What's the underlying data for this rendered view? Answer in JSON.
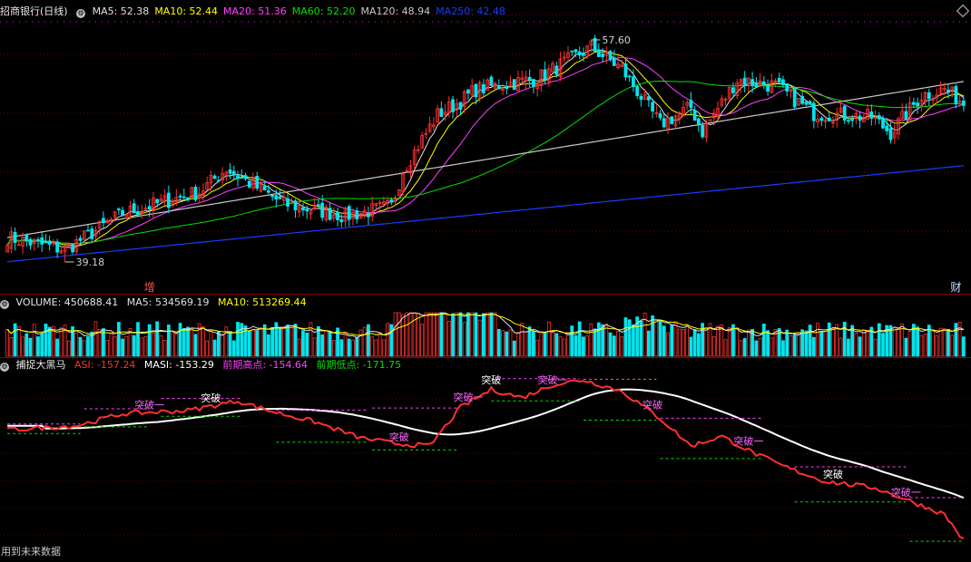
{
  "main_panel": {
    "title": "招商银行(日线)",
    "indicators": [
      {
        "label": "MA5: 52.38",
        "color": "#e0e0e0"
      },
      {
        "label": "MA10: 52.44",
        "color": "#ffff00"
      },
      {
        "label": "MA20: 51.36",
        "color": "#ff40ff"
      },
      {
        "label": "MA60: 52.20",
        "color": "#00e000"
      },
      {
        "label": "MA120: 48.94",
        "color": "#c8c8c8"
      },
      {
        "label": "MA250: 42.48",
        "color": "#1a3cff"
      }
    ],
    "high_label": "57.60",
    "low_label": "39.18",
    "markers": [
      {
        "label": "增",
        "color": "#ff5050",
        "x_index": 37
      },
      {
        "label": "财",
        "color": "#c8e0ff",
        "x_index": 247
      }
    ]
  },
  "volume_panel": {
    "title": "VOLUME: 450688.41",
    "ma5": "MA5: 534569.19",
    "ma10": "MA10: 513269.44",
    "ma5_color": "#e0e0e0",
    "ma10_color": "#ffff00"
  },
  "asi_panel": {
    "title": "捕捉大黑马",
    "asi": "ASI: -157.24",
    "masi": "MASI: -153.29",
    "prev_high": "前期高点: -154.64",
    "prev_low": "前期低点: -171.75",
    "asi_color": "#ff3030",
    "masi_color": "#ffffff",
    "prev_high_color": "#ff40ff",
    "prev_low_color": "#00e000",
    "breakout_labels": [
      {
        "text": "突破",
        "color": "#ffffff",
        "at": 53
      },
      {
        "text": "突破一",
        "color": "#ff66ff",
        "at": 37
      },
      {
        "text": "突破",
        "color": "#ff66ff",
        "at": 102
      },
      {
        "text": "突破一",
        "color": "#ff66ff",
        "at": 120
      },
      {
        "text": "突破",
        "color": "#ffffff",
        "at": 126
      },
      {
        "text": "突破一",
        "color": "#ff66ff",
        "at": 142
      },
      {
        "text": "突破",
        "color": "#ff66ff",
        "at": 168
      },
      {
        "text": "突破一",
        "color": "#ff66ff",
        "at": 193
      },
      {
        "text": "突破",
        "color": "#ffffff",
        "at": 215
      },
      {
        "text": "突破一",
        "color": "#ff66ff",
        "at": 234
      },
      {
        "text": "突破",
        "color": "#ff66ff",
        "at": 256
      },
      {
        "text": "突破",
        "color": "#ffffff",
        "at": 294
      }
    ]
  },
  "footer": {
    "text": "用到未来数据"
  },
  "icons": {
    "gear": "gear-icon",
    "corner": "diamond-icon"
  },
  "chart_data": {
    "type": "candlestick",
    "candle_count": 250,
    "price_range": [
      37.0,
      58.5
    ],
    "up_color": "#ff3030",
    "down_color": "#00e5ee",
    "anchors": [
      {
        "i": 0,
        "close": 41.2
      },
      {
        "i": 15,
        "close": 40.2
      },
      {
        "i": 30,
        "close": 43.2
      },
      {
        "i": 50,
        "close": 45.0
      },
      {
        "i": 57,
        "close": 46.9
      },
      {
        "i": 72,
        "close": 44.0
      },
      {
        "i": 88,
        "close": 43.0
      },
      {
        "i": 100,
        "close": 43.8
      },
      {
        "i": 103,
        "close": 46.8
      },
      {
        "i": 112,
        "close": 51.4
      },
      {
        "i": 118,
        "close": 52.5
      },
      {
        "i": 122,
        "close": 53.5
      },
      {
        "i": 138,
        "close": 54.4
      },
      {
        "i": 152,
        "close": 57.0
      },
      {
        "i": 160,
        "close": 55.2
      },
      {
        "i": 170,
        "close": 50.6
      },
      {
        "i": 178,
        "close": 52.0
      },
      {
        "i": 181,
        "close": 50.0
      },
      {
        "i": 190,
        "close": 54.3
      },
      {
        "i": 200,
        "close": 53.8
      },
      {
        "i": 210,
        "close": 51.5
      },
      {
        "i": 225,
        "close": 51.2
      },
      {
        "i": 230,
        "close": 49.9
      },
      {
        "i": 238,
        "close": 53.0
      },
      {
        "i": 244,
        "close": 53.5
      },
      {
        "i": 249,
        "close": 52.4
      }
    ],
    "asi_anchors": [
      {
        "i": 0,
        "v": -20
      },
      {
        "i": 18,
        "v": -15
      },
      {
        "i": 30,
        "v": 0
      },
      {
        "i": 47,
        "v": 4
      },
      {
        "i": 60,
        "v": 16
      },
      {
        "i": 68,
        "v": 4
      },
      {
        "i": 80,
        "v": -10
      },
      {
        "i": 92,
        "v": -30
      },
      {
        "i": 101,
        "v": -37
      },
      {
        "i": 110,
        "v": -40
      },
      {
        "i": 118,
        "v": 8
      },
      {
        "i": 126,
        "v": 30
      },
      {
        "i": 134,
        "v": 20
      },
      {
        "i": 142,
        "v": 36
      },
      {
        "i": 150,
        "v": 42
      },
      {
        "i": 160,
        "v": 28
      },
      {
        "i": 170,
        "v": -6
      },
      {
        "i": 178,
        "v": -40
      },
      {
        "i": 186,
        "v": -28
      },
      {
        "i": 194,
        "v": -48
      },
      {
        "i": 202,
        "v": -65
      },
      {
        "i": 213,
        "v": -84
      },
      {
        "i": 226,
        "v": -92
      },
      {
        "i": 236,
        "v": -110
      },
      {
        "i": 244,
        "v": -125
      },
      {
        "i": 249,
        "v": -157.24
      }
    ],
    "masi_last": -153.29,
    "prev_high_last": -154.64,
    "prev_low_last": -171.75
  }
}
